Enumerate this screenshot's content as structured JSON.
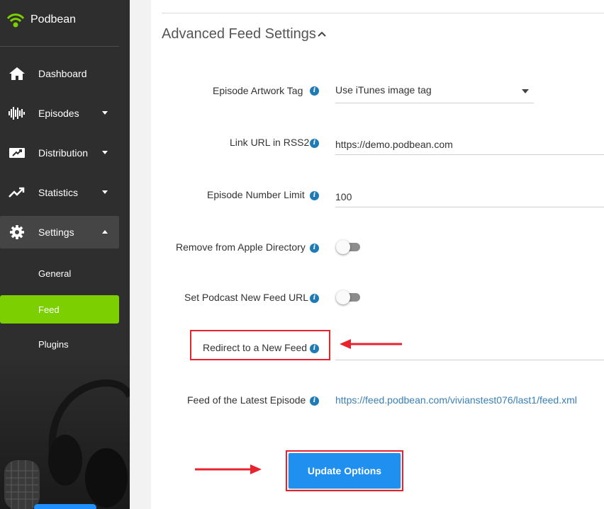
{
  "brand": {
    "name": "Podbean",
    "accent": "#7ccf00"
  },
  "sidebar": {
    "items": [
      {
        "label": "Dashboard",
        "icon": "home-icon"
      },
      {
        "label": "Episodes",
        "icon": "waveform-icon"
      },
      {
        "label": "Distribution",
        "icon": "distribution-icon"
      },
      {
        "label": "Statistics",
        "icon": "trending-up-icon"
      },
      {
        "label": "Settings",
        "icon": "gear-icon"
      }
    ],
    "settings_subitems": [
      {
        "label": "General"
      },
      {
        "label": "Feed"
      },
      {
        "label": "Plugins"
      }
    ]
  },
  "main": {
    "section_title": "Advanced Feed Settings",
    "rows": {
      "artwork_tag": {
        "label": "Episode Artwork Tag",
        "value": "Use iTunes image tag"
      },
      "link_url": {
        "label": "Link URL in RSS2",
        "value": "https://demo.podbean.com"
      },
      "episode_limit": {
        "label": "Episode Number Limit",
        "value": "100"
      },
      "remove_apple": {
        "label": "Remove from Apple Directory",
        "enabled": false
      },
      "new_feed_url": {
        "label": "Set Podcast New Feed URL",
        "enabled": false
      },
      "redirect": {
        "label": "Redirect to a New Feed",
        "value": ""
      },
      "latest_feed": {
        "label": "Feed of the Latest Episode",
        "value": "https://feed.podbean.com/vivianstest076/last1/feed.xml"
      }
    },
    "update_button": "Update Options"
  },
  "colors": {
    "sidebar_bg": "#2e2e2e",
    "button": "#1f8ff0",
    "annotation_red": "#e8232e",
    "info": "#1f7bb6"
  }
}
